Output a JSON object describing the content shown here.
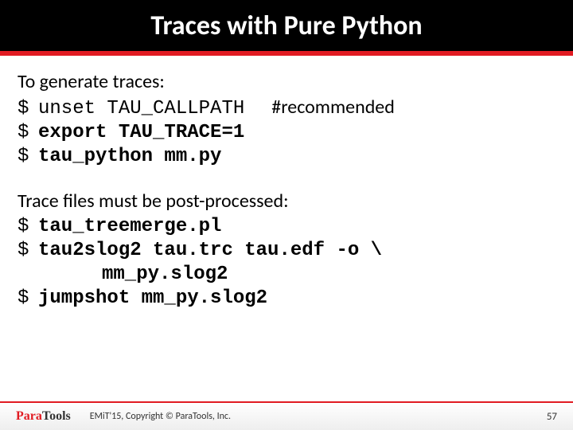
{
  "header": {
    "title": "Traces with Pure Python"
  },
  "section1": {
    "intro": "To generate traces:",
    "lines": [
      {
        "prompt": "$",
        "cmd": "unset TAU_CALLPATH",
        "bold": false,
        "comment": "#recommended"
      },
      {
        "prompt": "$",
        "cmd": "export TAU_TRACE=1",
        "bold": true
      },
      {
        "prompt": "$",
        "cmd": "tau_python mm.py",
        "bold": true
      }
    ]
  },
  "section2": {
    "intro": "Trace files must be post-processed:",
    "lines": [
      {
        "prompt": "$",
        "cmd": "tau_treemerge.pl",
        "bold": true
      },
      {
        "prompt": "$",
        "cmd": "tau2slog2 tau.trc tau.edf -o \\",
        "bold": true
      },
      {
        "prompt": "",
        "cmd": "mm_py.slog2",
        "bold": true,
        "indent": true
      },
      {
        "prompt": "$",
        "cmd": "jumpshot mm_py.slog2",
        "bold": true
      }
    ]
  },
  "footer": {
    "logo_left": "Para",
    "logo_right": "Tools",
    "copyright": "EMiT'15, Copyright © ParaTools, Inc.",
    "page": "57"
  }
}
